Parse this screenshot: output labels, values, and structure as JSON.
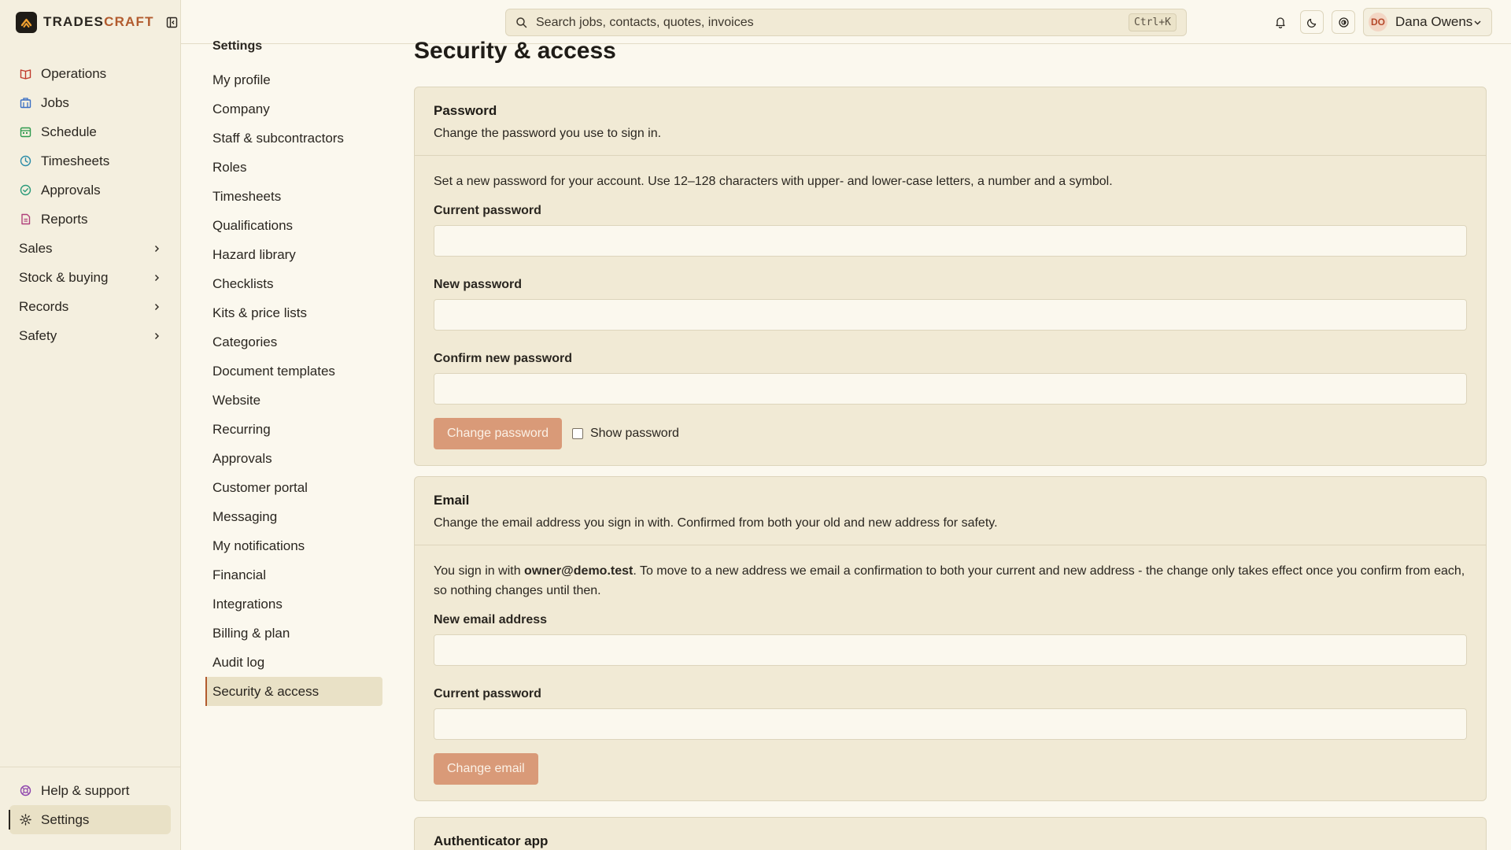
{
  "brand": {
    "name_part1": "TRADES",
    "name_part2": "CRAFT"
  },
  "sidebar": {
    "items": [
      {
        "label": "Operations",
        "icon": "book-icon",
        "color": "#c0392b"
      },
      {
        "label": "Jobs",
        "icon": "building-icon",
        "color": "#3a6fc4"
      },
      {
        "label": "Schedule",
        "icon": "calendar-icon",
        "color": "#2e9a4e"
      },
      {
        "label": "Timesheets",
        "icon": "clock-icon",
        "color": "#2b8ca8"
      },
      {
        "label": "Approvals",
        "icon": "check-circle-icon",
        "color": "#2b9a7a"
      },
      {
        "label": "Reports",
        "icon": "report-icon",
        "color": "#b0407a"
      }
    ],
    "groups": [
      {
        "label": "Sales"
      },
      {
        "label": "Stock & buying"
      },
      {
        "label": "Records"
      },
      {
        "label": "Safety"
      }
    ],
    "bottom": [
      {
        "label": "Help & support",
        "icon": "lifebuoy-icon",
        "color": "#8e44ad"
      },
      {
        "label": "Settings",
        "icon": "gear-icon",
        "color": "#2a2620"
      }
    ]
  },
  "search": {
    "placeholder": "Search jobs, contacts, quotes, invoices",
    "shortcut": "Ctrl+K"
  },
  "user": {
    "initials": "DO",
    "name": "Dana Owens"
  },
  "settings_nav": {
    "title": "Settings",
    "items": [
      "My profile",
      "Company",
      "Staff & subcontractors",
      "Roles",
      "Timesheets",
      "Qualifications",
      "Hazard library",
      "Checklists",
      "Kits & price lists",
      "Categories",
      "Document templates",
      "Website",
      "Recurring",
      "Approvals",
      "Customer portal",
      "Messaging",
      "My notifications",
      "Financial",
      "Integrations",
      "Billing & plan",
      "Audit log",
      "Security & access"
    ],
    "active": "Security & access"
  },
  "page": {
    "title": "Security & access"
  },
  "password_card": {
    "title": "Password",
    "subtitle": "Change the password you use to sign in.",
    "intro": "Set a new password for your account. Use 12–128 characters with upper- and lower-case letters, a number and a symbol.",
    "current_label": "Current password",
    "new_label": "New password",
    "confirm_label": "Confirm new password",
    "button": "Change password",
    "show_label": "Show password"
  },
  "email_card": {
    "title": "Email",
    "subtitle": "Change the email address you sign in with. Confirmed from both your old and new address for safety.",
    "intro_before": "You sign in with ",
    "current_email": "owner@demo.test",
    "intro_after": ". To move to a new address we email a confirmation to both your current and new address - the change only takes effect once you confirm from each, so nothing changes until then.",
    "new_email_label": "New email address",
    "password_label": "Current password",
    "button": "Change email"
  },
  "auth_card": {
    "title": "Authenticator app"
  },
  "colors": {
    "accent": "#b25b2e",
    "button": "#d99a78",
    "background": "#fbf8ee",
    "card": "#f1ead5"
  }
}
